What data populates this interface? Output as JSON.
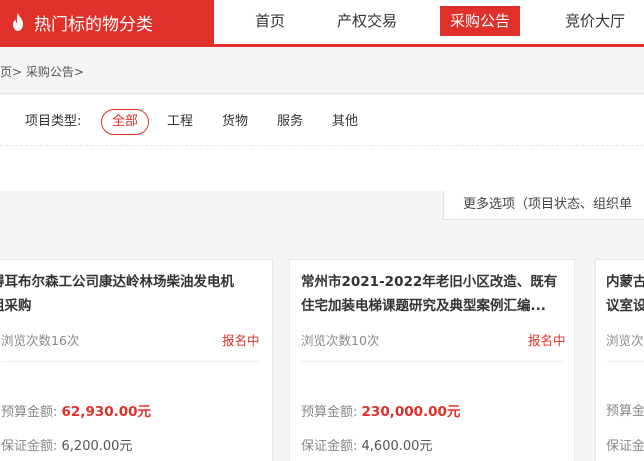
{
  "header": {
    "brand": "热门标的物分类",
    "nav": [
      "首页",
      "产权交易",
      "采购公告",
      "竞价大厅"
    ],
    "active_nav": "采购公告"
  },
  "breadcrumb": "页>  采购公告>",
  "filter": {
    "label": "项目类型:",
    "options": [
      "全部",
      "工程",
      "货物",
      "服务",
      "其他"
    ],
    "selected": "全部"
  },
  "more_options": "更多选项（项目状态、组织单",
  "cards": [
    {
      "title_line1": "得耳布尔森工公司康达岭林场柴油发电机",
      "title_line2": "组采购",
      "views_label": "浏览次数",
      "views_count": "16次",
      "status": "报名中",
      "budget_label": "预算金额:",
      "budget": "62,930.00元",
      "deposit_label": "保证金额:",
      "deposit": "6,200.00元"
    },
    {
      "title_line1": "常州市2021-2022年老旧小区改造、既有",
      "title_line2": "住宅加装电梯课题研究及典型案例汇编...",
      "views_label": "浏览次数",
      "views_count": "10次",
      "status": "报名中",
      "budget_label": "预算金额:",
      "budget": "230,000.00元",
      "deposit_label": "保证金额:",
      "deposit": "4,600.00元"
    },
    {
      "title_line1": "内蒙古",
      "title_line2": "议室设",
      "views_label": "浏览次数",
      "views_count": "",
      "status": "",
      "budget_label": "预算金",
      "budget": "",
      "deposit_label": "保证金",
      "deposit": ""
    }
  ],
  "colors": {
    "accent": "#e0302a"
  },
  "icons": {
    "brand": "flame-icon"
  }
}
